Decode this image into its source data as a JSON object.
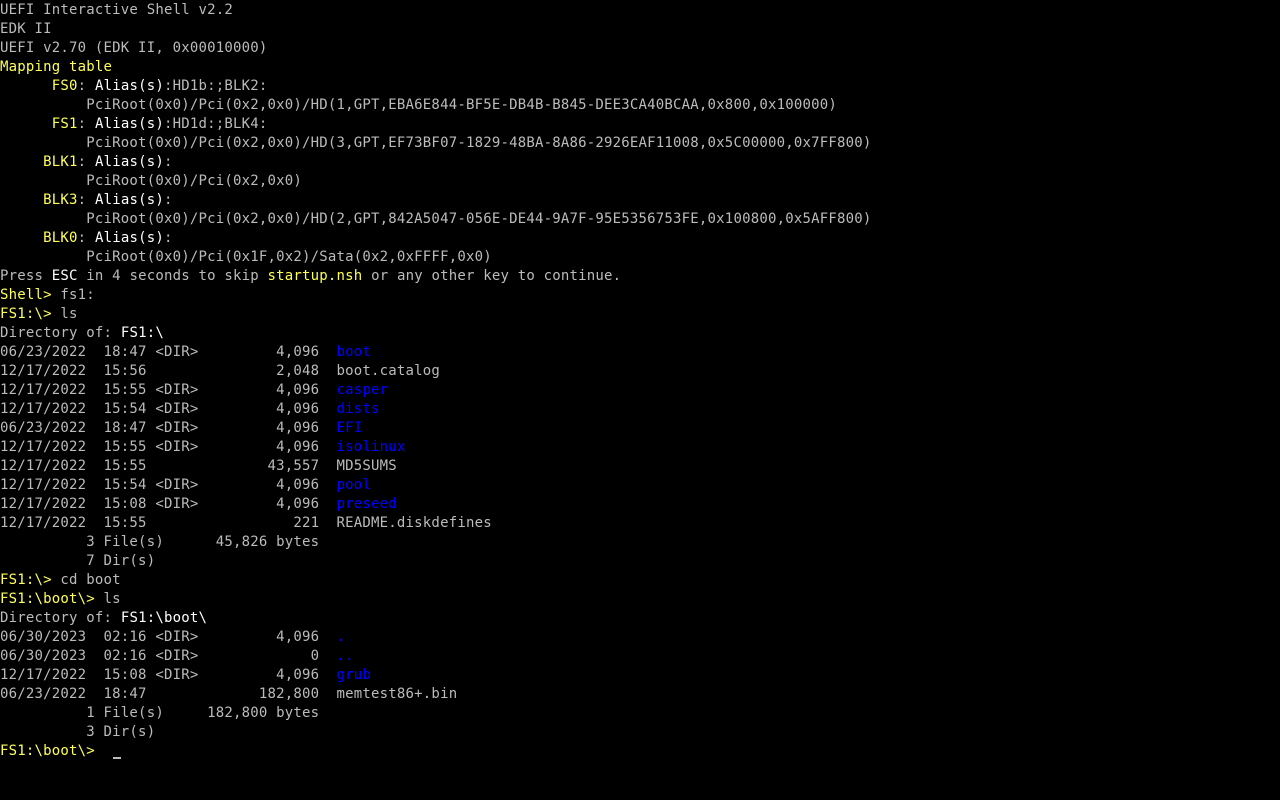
{
  "colors": {
    "background": "#000000",
    "gray": "#bbbbbb",
    "white": "#ffffff",
    "yellow": "#ffff55",
    "blue": "#0000ff"
  },
  "lines": [
    [
      {
        "t": "UEFI Interactive Shell v2.2",
        "c": "gray"
      }
    ],
    [
      {
        "t": "EDK II",
        "c": "gray"
      }
    ],
    [
      {
        "t": "UEFI v2.70 (EDK II, 0x00010000)",
        "c": "gray"
      }
    ],
    [
      {
        "t": "Mapping table",
        "c": "yellow"
      }
    ],
    [
      {
        "t": "      ",
        "c": "gray"
      },
      {
        "t": "FS0",
        "c": "yellow"
      },
      {
        "t": ": ",
        "c": "gray"
      },
      {
        "t": "Alias(s)",
        "c": "white"
      },
      {
        "t": ":HD1b:;BLK2:",
        "c": "gray"
      }
    ],
    [
      {
        "t": "          PciRoot(0x0)/Pci(0x2,0x0)/HD(1,GPT,EBA6E844-BF5E-DB4B-B845-DEE3CA40BCAA,0x800,0x100000)",
        "c": "gray"
      }
    ],
    [
      {
        "t": "      ",
        "c": "gray"
      },
      {
        "t": "FS1",
        "c": "yellow"
      },
      {
        "t": ": ",
        "c": "gray"
      },
      {
        "t": "Alias(s)",
        "c": "white"
      },
      {
        "t": ":HD1d:;BLK4:",
        "c": "gray"
      }
    ],
    [
      {
        "t": "          PciRoot(0x0)/Pci(0x2,0x0)/HD(3,GPT,EF73BF07-1829-48BA-8A86-2926EAF11008,0x5C00000,0x7FF800)",
        "c": "gray"
      }
    ],
    [
      {
        "t": "     ",
        "c": "gray"
      },
      {
        "t": "BLK1",
        "c": "yellow"
      },
      {
        "t": ": ",
        "c": "gray"
      },
      {
        "t": "Alias(s)",
        "c": "white"
      },
      {
        "t": ":",
        "c": "gray"
      }
    ],
    [
      {
        "t": "          PciRoot(0x0)/Pci(0x2,0x0)",
        "c": "gray"
      }
    ],
    [
      {
        "t": "     ",
        "c": "gray"
      },
      {
        "t": "BLK3",
        "c": "yellow"
      },
      {
        "t": ": ",
        "c": "gray"
      },
      {
        "t": "Alias(s)",
        "c": "white"
      },
      {
        "t": ":",
        "c": "gray"
      }
    ],
    [
      {
        "t": "          PciRoot(0x0)/Pci(0x2,0x0)/HD(2,GPT,842A5047-056E-DE44-9A7F-95E5356753FE,0x100800,0x5AFF800)",
        "c": "gray"
      }
    ],
    [
      {
        "t": "     ",
        "c": "gray"
      },
      {
        "t": "BLK0",
        "c": "yellow"
      },
      {
        "t": ": ",
        "c": "gray"
      },
      {
        "t": "Alias(s)",
        "c": "white"
      },
      {
        "t": ":",
        "c": "gray"
      }
    ],
    [
      {
        "t": "          PciRoot(0x0)/Pci(0x1F,0x2)/Sata(0x2,0xFFFF,0x0)",
        "c": "gray"
      }
    ],
    [
      {
        "t": "Press ",
        "c": "gray"
      },
      {
        "t": "ESC",
        "c": "white"
      },
      {
        "t": " in 4 seconds to skip ",
        "c": "gray"
      },
      {
        "t": "startup.nsh",
        "c": "yellow"
      },
      {
        "t": " or any other key to continue.",
        "c": "gray"
      }
    ],
    [
      {
        "t": "Shell> ",
        "c": "yellow"
      },
      {
        "t": "fs1:",
        "c": "gray"
      }
    ],
    [
      {
        "t": "FS1:\\> ",
        "c": "yellow"
      },
      {
        "t": "ls",
        "c": "gray"
      }
    ],
    [
      {
        "t": "Directory of: ",
        "c": "gray"
      },
      {
        "t": "FS1:\\",
        "c": "white"
      }
    ],
    [
      {
        "t": "06/23/2022  18:47 <DIR>         4,096  ",
        "c": "gray"
      },
      {
        "t": "boot",
        "c": "blue"
      }
    ],
    [
      {
        "t": "12/17/2022  15:56               2,048  boot.catalog",
        "c": "gray"
      }
    ],
    [
      {
        "t": "12/17/2022  15:55 <DIR>         4,096  ",
        "c": "gray"
      },
      {
        "t": "casper",
        "c": "blue"
      }
    ],
    [
      {
        "t": "12/17/2022  15:54 <DIR>         4,096  ",
        "c": "gray"
      },
      {
        "t": "dists",
        "c": "blue"
      }
    ],
    [
      {
        "t": "06/23/2022  18:47 <DIR>         4,096  ",
        "c": "gray"
      },
      {
        "t": "EFI",
        "c": "blue"
      }
    ],
    [
      {
        "t": "12/17/2022  15:55 <DIR>         4,096  ",
        "c": "gray"
      },
      {
        "t": "isolinux",
        "c": "blue"
      }
    ],
    [
      {
        "t": "12/17/2022  15:55              43,557  MD5SUMS",
        "c": "gray"
      }
    ],
    [
      {
        "t": "12/17/2022  15:54 <DIR>         4,096  ",
        "c": "gray"
      },
      {
        "t": "pool",
        "c": "blue"
      }
    ],
    [
      {
        "t": "12/17/2022  15:08 <DIR>         4,096  ",
        "c": "gray"
      },
      {
        "t": "preseed",
        "c": "blue"
      }
    ],
    [
      {
        "t": "12/17/2022  15:55                 221  README.diskdefines",
        "c": "gray"
      }
    ],
    [
      {
        "t": "          3 File(s)      45,826 bytes",
        "c": "gray"
      }
    ],
    [
      {
        "t": "          7 Dir(s)",
        "c": "gray"
      }
    ],
    [
      {
        "t": "FS1:\\> ",
        "c": "yellow"
      },
      {
        "t": "cd boot",
        "c": "gray"
      }
    ],
    [
      {
        "t": "FS1:\\boot\\> ",
        "c": "yellow"
      },
      {
        "t": "ls",
        "c": "gray"
      }
    ],
    [
      {
        "t": "Directory of: ",
        "c": "gray"
      },
      {
        "t": "FS1:\\boot\\",
        "c": "white"
      }
    ],
    [
      {
        "t": "06/30/2023  02:16 <DIR>         4,096  ",
        "c": "gray"
      },
      {
        "t": ".",
        "c": "blue"
      }
    ],
    [
      {
        "t": "06/30/2023  02:16 <DIR>             0  ",
        "c": "gray"
      },
      {
        "t": "..",
        "c": "blue"
      }
    ],
    [
      {
        "t": "12/17/2022  15:08 <DIR>         4,096  ",
        "c": "gray"
      },
      {
        "t": "grub",
        "c": "blue"
      }
    ],
    [
      {
        "t": "06/23/2022  18:47             182,800  memtest86+.bin",
        "c": "gray"
      }
    ],
    [
      {
        "t": "          1 File(s)     182,800 bytes",
        "c": "gray"
      }
    ],
    [
      {
        "t": "          3 Dir(s)",
        "c": "gray"
      }
    ],
    [
      {
        "t": "FS1:\\boot\\> ",
        "c": "yellow"
      }
    ]
  ]
}
